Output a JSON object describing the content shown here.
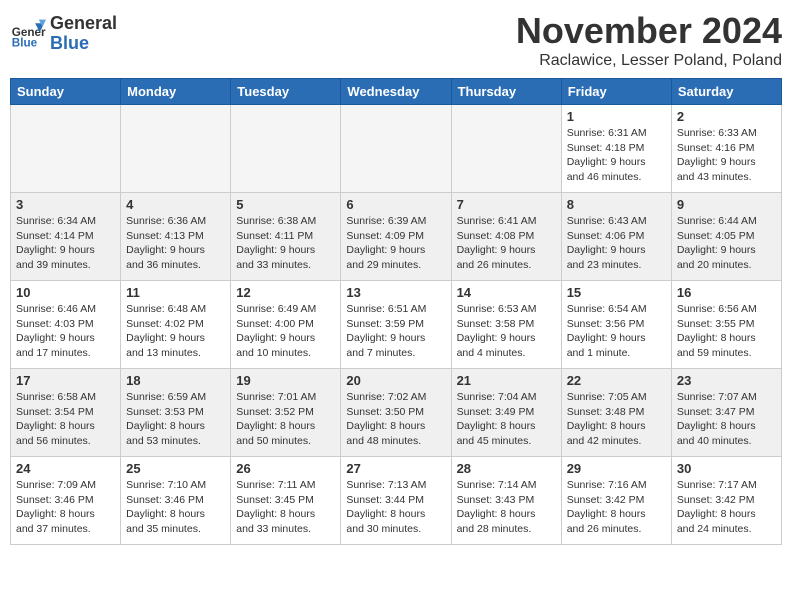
{
  "header": {
    "logo": {
      "line1": "General",
      "line2": "Blue"
    },
    "month": "November 2024",
    "location": "Raclawice, Lesser Poland, Poland"
  },
  "weekdays": [
    "Sunday",
    "Monday",
    "Tuesday",
    "Wednesday",
    "Thursday",
    "Friday",
    "Saturday"
  ],
  "weeks": [
    [
      {
        "day": "",
        "info": ""
      },
      {
        "day": "",
        "info": ""
      },
      {
        "day": "",
        "info": ""
      },
      {
        "day": "",
        "info": ""
      },
      {
        "day": "",
        "info": ""
      },
      {
        "day": "1",
        "info": "Sunrise: 6:31 AM\nSunset: 4:18 PM\nDaylight: 9 hours\nand 46 minutes."
      },
      {
        "day": "2",
        "info": "Sunrise: 6:33 AM\nSunset: 4:16 PM\nDaylight: 9 hours\nand 43 minutes."
      }
    ],
    [
      {
        "day": "3",
        "info": "Sunrise: 6:34 AM\nSunset: 4:14 PM\nDaylight: 9 hours\nand 39 minutes."
      },
      {
        "day": "4",
        "info": "Sunrise: 6:36 AM\nSunset: 4:13 PM\nDaylight: 9 hours\nand 36 minutes."
      },
      {
        "day": "5",
        "info": "Sunrise: 6:38 AM\nSunset: 4:11 PM\nDaylight: 9 hours\nand 33 minutes."
      },
      {
        "day": "6",
        "info": "Sunrise: 6:39 AM\nSunset: 4:09 PM\nDaylight: 9 hours\nand 29 minutes."
      },
      {
        "day": "7",
        "info": "Sunrise: 6:41 AM\nSunset: 4:08 PM\nDaylight: 9 hours\nand 26 minutes."
      },
      {
        "day": "8",
        "info": "Sunrise: 6:43 AM\nSunset: 4:06 PM\nDaylight: 9 hours\nand 23 minutes."
      },
      {
        "day": "9",
        "info": "Sunrise: 6:44 AM\nSunset: 4:05 PM\nDaylight: 9 hours\nand 20 minutes."
      }
    ],
    [
      {
        "day": "10",
        "info": "Sunrise: 6:46 AM\nSunset: 4:03 PM\nDaylight: 9 hours\nand 17 minutes."
      },
      {
        "day": "11",
        "info": "Sunrise: 6:48 AM\nSunset: 4:02 PM\nDaylight: 9 hours\nand 13 minutes."
      },
      {
        "day": "12",
        "info": "Sunrise: 6:49 AM\nSunset: 4:00 PM\nDaylight: 9 hours\nand 10 minutes."
      },
      {
        "day": "13",
        "info": "Sunrise: 6:51 AM\nSunset: 3:59 PM\nDaylight: 9 hours\nand 7 minutes."
      },
      {
        "day": "14",
        "info": "Sunrise: 6:53 AM\nSunset: 3:58 PM\nDaylight: 9 hours\nand 4 minutes."
      },
      {
        "day": "15",
        "info": "Sunrise: 6:54 AM\nSunset: 3:56 PM\nDaylight: 9 hours\nand 1 minute."
      },
      {
        "day": "16",
        "info": "Sunrise: 6:56 AM\nSunset: 3:55 PM\nDaylight: 8 hours\nand 59 minutes."
      }
    ],
    [
      {
        "day": "17",
        "info": "Sunrise: 6:58 AM\nSunset: 3:54 PM\nDaylight: 8 hours\nand 56 minutes."
      },
      {
        "day": "18",
        "info": "Sunrise: 6:59 AM\nSunset: 3:53 PM\nDaylight: 8 hours\nand 53 minutes."
      },
      {
        "day": "19",
        "info": "Sunrise: 7:01 AM\nSunset: 3:52 PM\nDaylight: 8 hours\nand 50 minutes."
      },
      {
        "day": "20",
        "info": "Sunrise: 7:02 AM\nSunset: 3:50 PM\nDaylight: 8 hours\nand 48 minutes."
      },
      {
        "day": "21",
        "info": "Sunrise: 7:04 AM\nSunset: 3:49 PM\nDaylight: 8 hours\nand 45 minutes."
      },
      {
        "day": "22",
        "info": "Sunrise: 7:05 AM\nSunset: 3:48 PM\nDaylight: 8 hours\nand 42 minutes."
      },
      {
        "day": "23",
        "info": "Sunrise: 7:07 AM\nSunset: 3:47 PM\nDaylight: 8 hours\nand 40 minutes."
      }
    ],
    [
      {
        "day": "24",
        "info": "Sunrise: 7:09 AM\nSunset: 3:46 PM\nDaylight: 8 hours\nand 37 minutes."
      },
      {
        "day": "25",
        "info": "Sunrise: 7:10 AM\nSunset: 3:46 PM\nDaylight: 8 hours\nand 35 minutes."
      },
      {
        "day": "26",
        "info": "Sunrise: 7:11 AM\nSunset: 3:45 PM\nDaylight: 8 hours\nand 33 minutes."
      },
      {
        "day": "27",
        "info": "Sunrise: 7:13 AM\nSunset: 3:44 PM\nDaylight: 8 hours\nand 30 minutes."
      },
      {
        "day": "28",
        "info": "Sunrise: 7:14 AM\nSunset: 3:43 PM\nDaylight: 8 hours\nand 28 minutes."
      },
      {
        "day": "29",
        "info": "Sunrise: 7:16 AM\nSunset: 3:42 PM\nDaylight: 8 hours\nand 26 minutes."
      },
      {
        "day": "30",
        "info": "Sunrise: 7:17 AM\nSunset: 3:42 PM\nDaylight: 8 hours\nand 24 minutes."
      }
    ]
  ]
}
